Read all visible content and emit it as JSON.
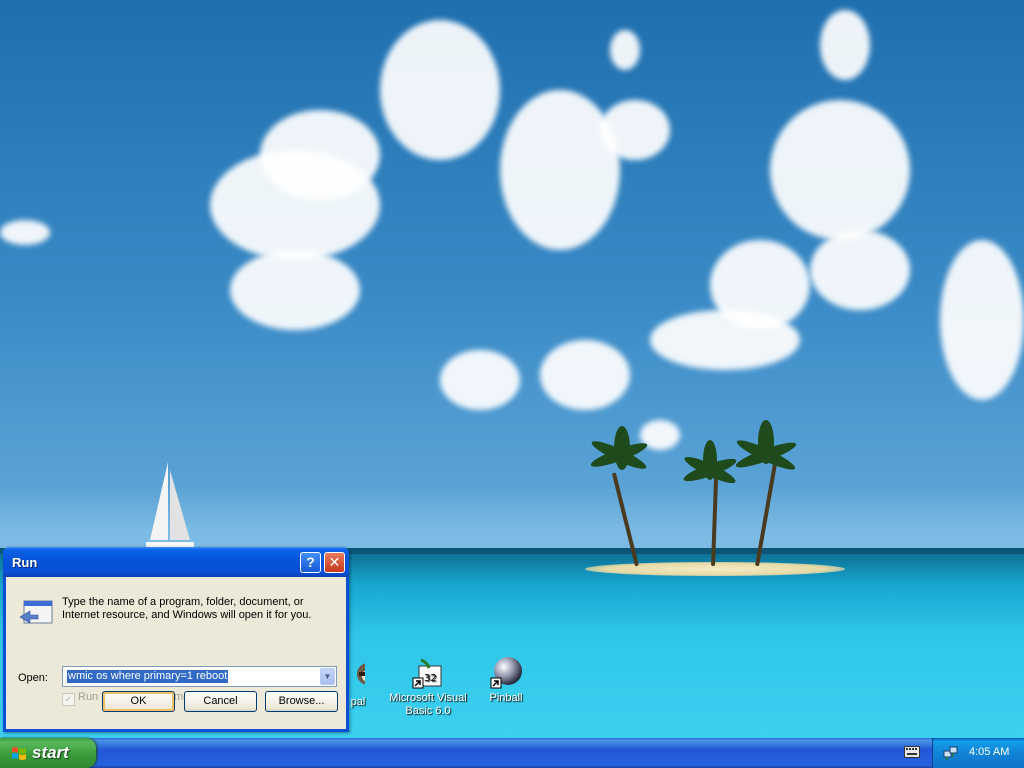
{
  "desktop": {
    "icons": [
      {
        "name": "desktop-icon-paypal",
        "label": "pal"
      },
      {
        "name": "desktop-icon-vb6",
        "label": "Microsoft Visual Basic 6.0"
      },
      {
        "name": "desktop-icon-pinball",
        "label": "Pinball"
      }
    ]
  },
  "run_dialog": {
    "title": "Run",
    "help_glyph": "?",
    "close_glyph": "✕",
    "prompt": "Type the name of a program, folder, document, or Internet resource, and Windows will open it for you.",
    "open_label": "Open:",
    "command_value": "wmic os where primary=1 reboot",
    "separate_memory_label": "Run in separate memory space",
    "separate_memory_checked": true,
    "ok_label": "OK",
    "cancel_label": "Cancel",
    "browse_label": "Browse..."
  },
  "taskbar": {
    "start_label": "start",
    "clock": "4:05 AM"
  },
  "colors": {
    "title_bar": "#0553d8",
    "dialog_face": "#ece9d8",
    "start_green": "#379a3a",
    "taskbar_blue": "#2157d7",
    "selection": "#316ac5"
  }
}
